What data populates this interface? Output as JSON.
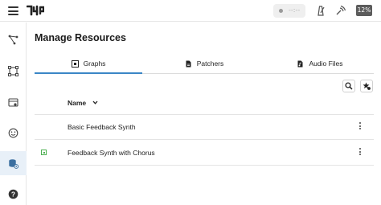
{
  "topbar": {
    "status_text": "--:--",
    "cpu_badge": "12%"
  },
  "sidebar": {
    "items": [
      {
        "icon": "graph-editor-icon"
      },
      {
        "icon": "patcher-icon"
      },
      {
        "icon": "instruments-icon"
      },
      {
        "icon": "face-icon"
      },
      {
        "icon": "resources-icon",
        "active": true
      },
      {
        "icon": "help-icon"
      }
    ]
  },
  "main": {
    "title": "Manage Resources",
    "tabs": [
      {
        "label": "Graphs",
        "icon": "graphs-tab-icon",
        "active": true
      },
      {
        "label": "Patchers",
        "icon": "file-icon"
      },
      {
        "label": "Audio Files",
        "icon": "audio-file-icon"
      }
    ],
    "table": {
      "column_name": "Name",
      "rows": [
        {
          "name": "Basic Feedback Synth",
          "loaded": false
        },
        {
          "name": "Feedback Synth with Chorus",
          "loaded": true
        }
      ]
    }
  },
  "colors": {
    "accent": "#3b86c6",
    "active_sidebar_bg": "#e8f0f8",
    "loaded_indicator": "#4caf50",
    "cpu_badge_bg": "#5c5c5c"
  }
}
